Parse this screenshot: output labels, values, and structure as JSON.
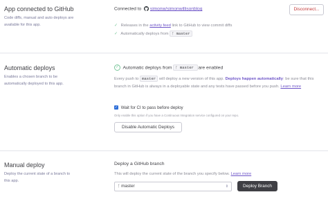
{
  "github": {
    "title": "App connected to GitHub",
    "description": "Code diffs, manual and auto deploys are available for this app.",
    "connected_prefix": "Connected to",
    "repo": "simonw/simonwillisonblog",
    "disconnect_label": "Disconnect...",
    "releases_text_1": "Releases in the",
    "releases_link": "activity feed",
    "releases_text_2": "link to GitHub to view commit diffs",
    "auto_deploys_text": "Automatically deploys from",
    "branch": "master"
  },
  "auto": {
    "title": "Automatic deploys",
    "description": "Enables a chosen branch to be automatically deployed to this app.",
    "status_prefix": "Automatic deploys from",
    "branch": "master",
    "status_suffix": "are enabled",
    "info_1": "Every push to",
    "info_branch": "master",
    "info_2": "will deploy a new version of this app.",
    "info_bold": "Deploys happen automatically",
    "info_3": ": be sure that this branch in GitHub is always in a deployable state and any tests have passed before you push.",
    "learn_more": "Learn more",
    "ci_label": "Wait for CI to pass before deploy",
    "ci_checked": true,
    "ci_note": "Only enable this option if you have a Continuous Integration service configured on your repo.",
    "disable_label": "Disable Automatic Deploys"
  },
  "manual": {
    "title": "Manual deploy",
    "description": "Deploy the current state of a branch to this app.",
    "heading": "Deploy a GitHub branch",
    "info": "This will deploy the current state of the branch you specify below.",
    "learn_more": "Learn more",
    "branch_value": "master",
    "deploy_label": "Deploy Branch"
  },
  "colors": {
    "accent": "#6e55c8",
    "success": "#79c79a",
    "danger": "#c43b3b",
    "primary_button": "#3f3f44"
  }
}
